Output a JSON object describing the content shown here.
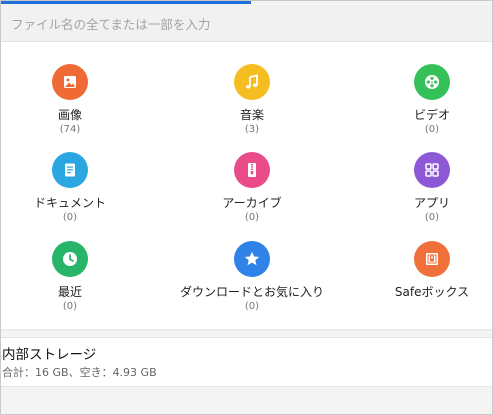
{
  "search": {
    "placeholder": "ファイル名の全てまたは一部を入力"
  },
  "categories": [
    {
      "label": "画像",
      "count": "(74)",
      "icon": "image-icon",
      "color": "#ef6a35"
    },
    {
      "label": "音楽",
      "count": "(3)",
      "icon": "music-note-icon",
      "color": "#f5bd20"
    },
    {
      "label": "ビデオ",
      "count": "(0)",
      "icon": "film-reel-icon",
      "color": "#35c05a"
    },
    {
      "label": "ドキュメント",
      "count": "(0)",
      "icon": "document-icon",
      "color": "#2aa7e0"
    },
    {
      "label": "アーカイブ",
      "count": "(0)",
      "icon": "zip-archive-icon",
      "color": "#ea4c89"
    },
    {
      "label": "アプリ",
      "count": "(0)",
      "icon": "apps-grid-icon",
      "color": "#8d58d6"
    },
    {
      "label": "最近",
      "count": "(0)",
      "icon": "clock-icon",
      "color": "#27b56a"
    },
    {
      "label": "ダウンロードとお気に入り",
      "count": "(0)",
      "icon": "star-icon",
      "color": "#2f82e8"
    },
    {
      "label": "Safeボックス",
      "count": "",
      "icon": "safe-lock-icon",
      "color": "#f0703a"
    }
  ],
  "storage": {
    "title": "内部ストレージ",
    "detail": "合計：16 GB、空き：4.93 GB"
  }
}
